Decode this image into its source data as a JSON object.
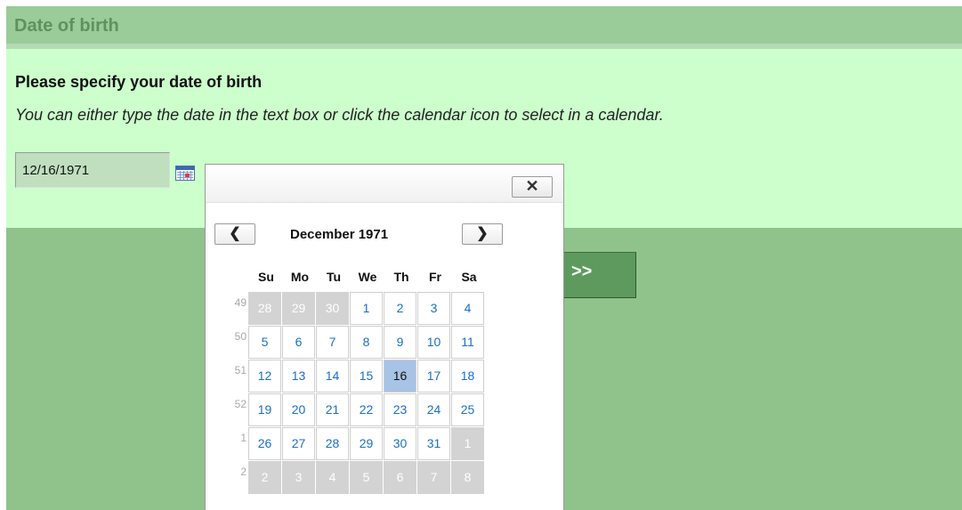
{
  "header": {
    "title": "Date of birth"
  },
  "form": {
    "question": "Please specify your date of birth",
    "hint": "You can either type the date in the text box or click the calendar icon to select in a calendar.",
    "date_value": "12/16/1971",
    "next_label": ">>"
  },
  "calendar": {
    "close_label": "✕",
    "prev_label": "❮",
    "next_label": "❯",
    "month_title": "December 1971",
    "weekdays": [
      "Su",
      "Mo",
      "Tu",
      "We",
      "Th",
      "Fr",
      "Sa"
    ],
    "selected_day": "16",
    "weeks": [
      {
        "week": "49",
        "days": [
          {
            "d": "28",
            "m": "other"
          },
          {
            "d": "29",
            "m": "other"
          },
          {
            "d": "30",
            "m": "other"
          },
          {
            "d": "1",
            "m": "current"
          },
          {
            "d": "2",
            "m": "current"
          },
          {
            "d": "3",
            "m": "current"
          },
          {
            "d": "4",
            "m": "current"
          }
        ]
      },
      {
        "week": "50",
        "days": [
          {
            "d": "5",
            "m": "current"
          },
          {
            "d": "6",
            "m": "current"
          },
          {
            "d": "7",
            "m": "current"
          },
          {
            "d": "8",
            "m": "current"
          },
          {
            "d": "9",
            "m": "current"
          },
          {
            "d": "10",
            "m": "current"
          },
          {
            "d": "11",
            "m": "current"
          }
        ]
      },
      {
        "week": "51",
        "days": [
          {
            "d": "12",
            "m": "current"
          },
          {
            "d": "13",
            "m": "current"
          },
          {
            "d": "14",
            "m": "current"
          },
          {
            "d": "15",
            "m": "current"
          },
          {
            "d": "16",
            "m": "current"
          },
          {
            "d": "17",
            "m": "current"
          },
          {
            "d": "18",
            "m": "current"
          }
        ]
      },
      {
        "week": "52",
        "days": [
          {
            "d": "19",
            "m": "current"
          },
          {
            "d": "20",
            "m": "current"
          },
          {
            "d": "21",
            "m": "current"
          },
          {
            "d": "22",
            "m": "current"
          },
          {
            "d": "23",
            "m": "current"
          },
          {
            "d": "24",
            "m": "current"
          },
          {
            "d": "25",
            "m": "current"
          }
        ]
      },
      {
        "week": "1",
        "days": [
          {
            "d": "26",
            "m": "current"
          },
          {
            "d": "27",
            "m": "current"
          },
          {
            "d": "28",
            "m": "current"
          },
          {
            "d": "29",
            "m": "current"
          },
          {
            "d": "30",
            "m": "current"
          },
          {
            "d": "31",
            "m": "current"
          },
          {
            "d": "1",
            "m": "other"
          }
        ]
      },
      {
        "week": "2",
        "days": [
          {
            "d": "2",
            "m": "other"
          },
          {
            "d": "3",
            "m": "other"
          },
          {
            "d": "4",
            "m": "other"
          },
          {
            "d": "5",
            "m": "other"
          },
          {
            "d": "6",
            "m": "other"
          },
          {
            "d": "7",
            "m": "other"
          },
          {
            "d": "8",
            "m": "other"
          }
        ]
      }
    ]
  },
  "icons": {
    "calendar": "calendar-icon",
    "close": "close-icon",
    "prev": "chevron-left-icon",
    "next": "chevron-right-icon"
  },
  "colors": {
    "header_bg": "#99cc99",
    "content_bg": "#ccffcc",
    "lower_bg": "#90c28b",
    "day_link": "#1a6fc3",
    "selected_bg": "#a7c3e6",
    "other_month_bg": "#d3d3d3"
  }
}
